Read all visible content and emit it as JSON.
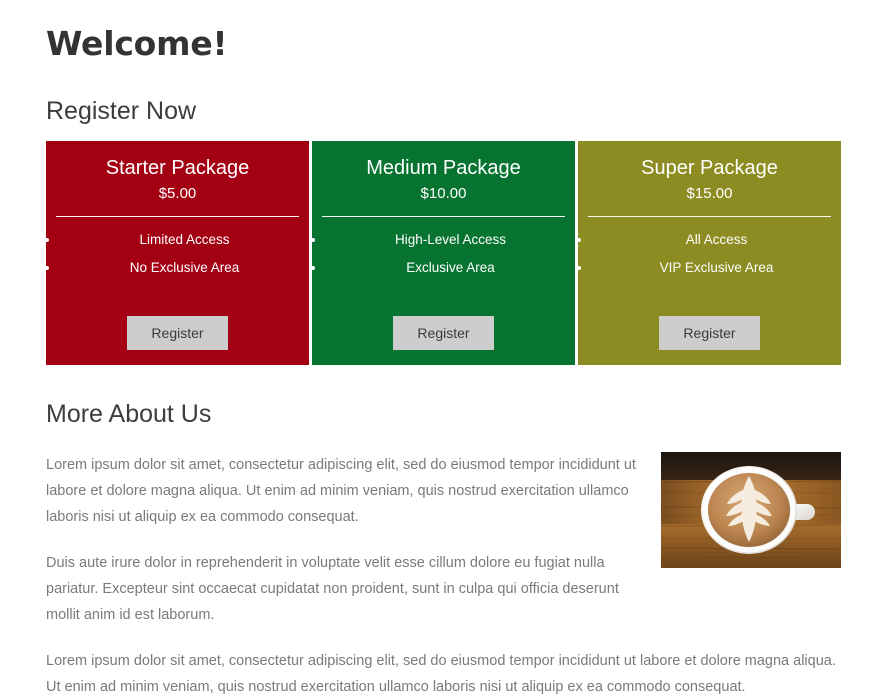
{
  "page": {
    "welcome_title": "Welcome!",
    "register_heading": "Register Now",
    "about_heading": "More About Us"
  },
  "colors": {
    "starter": "#a30014",
    "medium": "#067330",
    "super": "#8c8c22",
    "button_bg": "#cdcdcd",
    "button_text": "#3b3b3b",
    "heading_text": "#3d3d3d",
    "body_text": "#7a7a7a",
    "card_text": "#ffffff",
    "page_bg": "#ffffff"
  },
  "packages": [
    {
      "id": "starter",
      "title": "Starter Package",
      "price": "$5.00",
      "features": [
        "Limited Access",
        "No Exclusive Area"
      ],
      "button_label": "Register"
    },
    {
      "id": "medium",
      "title": "Medium Package",
      "price": "$10.00",
      "features": [
        "High-Level Access",
        "Exclusive Area"
      ],
      "button_label": "Register"
    },
    {
      "id": "super",
      "title": "Super Package",
      "price": "$15.00",
      "features": [
        "All Access",
        "VIP Exclusive Area"
      ],
      "button_label": "Register"
    }
  ],
  "about": {
    "image_alt": "coffee-cup-latte-art-on-wooden-table",
    "paragraphs": [
      "Lorem ipsum dolor sit amet, consectetur adipiscing elit, sed do eiusmod tempor incididunt ut labore et dolore magna aliqua. Ut enim ad minim veniam, quis nostrud exercitation ullamco laboris nisi ut aliquip ex ea commodo consequat.",
      "Duis aute irure dolor in reprehenderit in voluptate velit esse cillum dolore eu fugiat nulla pariatur. Excepteur sint occaecat cupidatat non proident, sunt in culpa qui officia deserunt mollit anim id est laborum.",
      "Lorem ipsum dolor sit amet, consectetur adipiscing elit, sed do eiusmod tempor incididunt ut labore et dolore magna aliqua. Ut enim ad minim veniam, quis nostrud exercitation ullamco laboris nisi ut aliquip ex ea commodo consequat."
    ]
  }
}
